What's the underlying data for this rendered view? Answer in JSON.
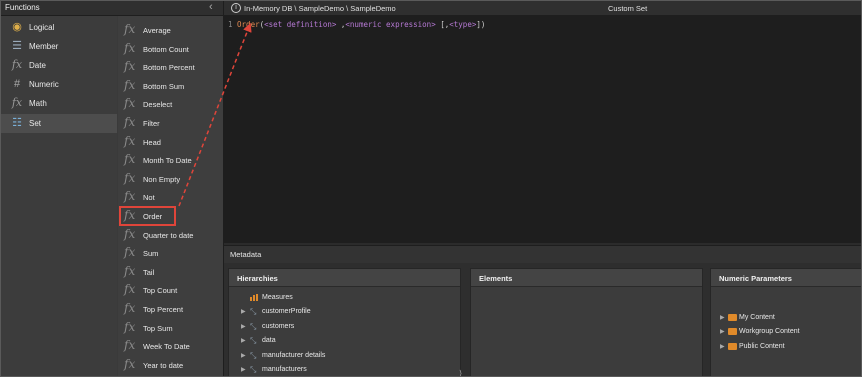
{
  "functions_panel": {
    "title": "Functions",
    "collapse_glyph": "‹",
    "categories": [
      {
        "label": "Logical",
        "icon": "logical-icon",
        "glyph": "◉"
      },
      {
        "label": "Member",
        "icon": "member-icon",
        "glyph": "☰"
      },
      {
        "label": "Date",
        "icon": "date-icon",
        "glyph": "fx"
      },
      {
        "label": "Numeric",
        "icon": "numeric-icon",
        "glyph": "#"
      },
      {
        "label": "Math",
        "icon": "math-icon",
        "glyph": "fx"
      },
      {
        "label": "Set",
        "icon": "set-icon",
        "glyph": "☷"
      }
    ],
    "selected_category": "Set",
    "functions": [
      "Average",
      "Bottom Count",
      "Bottom Percent",
      "Bottom Sum",
      "Deselect",
      "Filter",
      "Head",
      "Month To Date",
      "Non Empty",
      "Not",
      "Order",
      "Quarter to date",
      "Sum",
      "Tail",
      "Top Count",
      "Top Percent",
      "Top Sum",
      "Week To Date",
      "Year to date"
    ],
    "fx_glyph": "fx",
    "highlighted_function": "Order"
  },
  "editor": {
    "path": "In-Memory DB \\ SampleDemo \\ SampleDemo",
    "info_glyph": "i",
    "title": "Custom Set",
    "line_number": "1",
    "code": {
      "func": "Order",
      "open": "(",
      "arg1": "<set definition>",
      "sep1": " ,",
      "arg2": "<numeric expression>",
      "sep2": " [,",
      "arg3": "<type>",
      "close": "])"
    }
  },
  "metadata": {
    "title": "Metadata",
    "hierarchies": {
      "title": "Hierarchies",
      "items": [
        "Measures",
        "customerProfile",
        "customers",
        "data",
        "manufacturer details",
        "manufacturers"
      ]
    },
    "elements": {
      "title": "Elements"
    },
    "numeric_parameters": {
      "title": "Numeric Parameters",
      "items": [
        "My Content",
        "Workgroup Content",
        "Public Content"
      ]
    },
    "split_glyph": "⟩"
  },
  "colors": {
    "highlight": "#e0453a",
    "keyword": "#e58a52",
    "placeholder": "#b679d4",
    "folder": "#e08a2a"
  }
}
